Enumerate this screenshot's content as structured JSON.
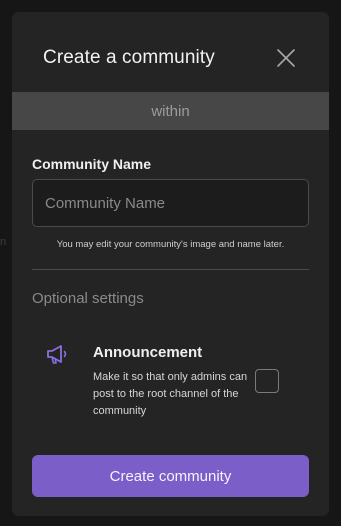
{
  "background": {
    "fragment_text": "n"
  },
  "modal": {
    "title": "Create a community",
    "close_icon": "close-icon",
    "within_label": "within",
    "community_name": {
      "label": "Community Name",
      "placeholder": "Community Name",
      "value": ""
    },
    "hint": "You may edit your community's image and name later.",
    "optional_heading": "Optional settings",
    "announcement": {
      "icon": "megaphone-icon",
      "title": "Announcement",
      "description": "Make it so that only admins can post to the root channel of the community",
      "checked": false
    },
    "submit_label": "Create community"
  },
  "colors": {
    "accent": "#7b5ec7",
    "icon_accent": "#8b6fe0",
    "modal_bg": "#242424",
    "band_bg": "#474747"
  }
}
